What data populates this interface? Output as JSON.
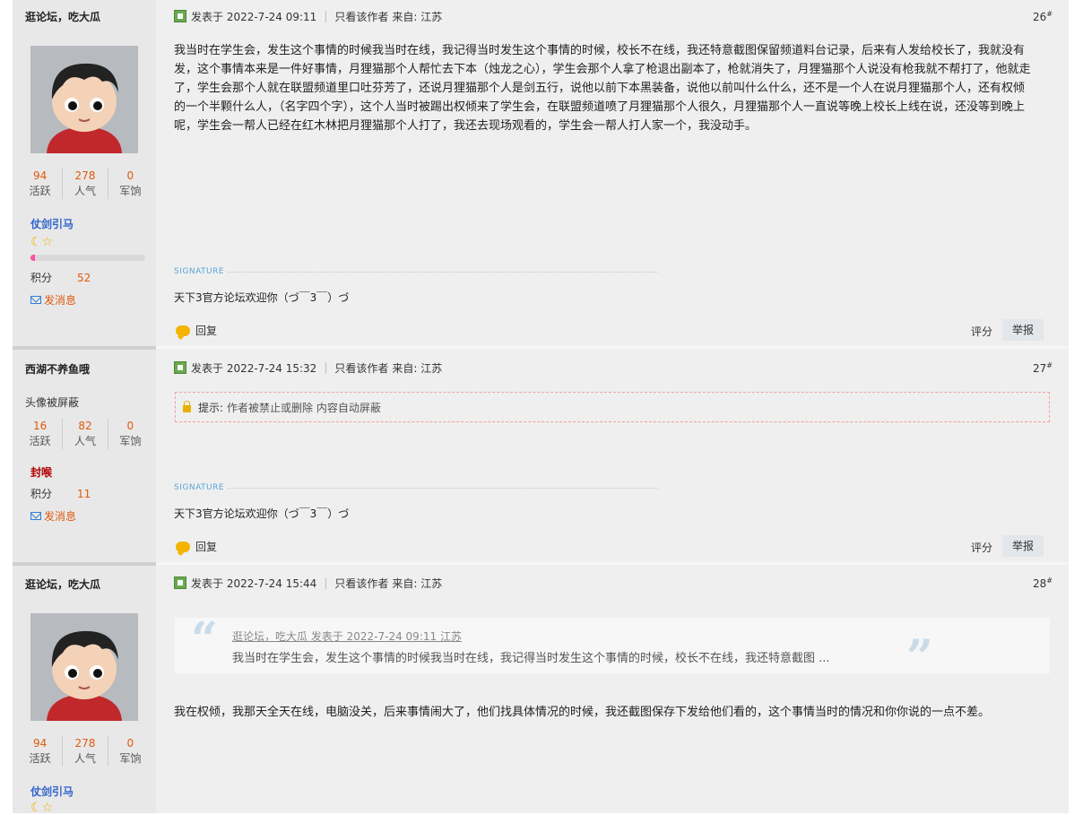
{
  "posts": [
    {
      "author": "逛论坛，吃大瓜",
      "stats": [
        {
          "n": "94",
          "l": "活跃"
        },
        {
          "n": "278",
          "l": "人气"
        },
        {
          "n": "0",
          "l": "军饷"
        }
      ],
      "group": "仗剑引马",
      "level_icons": "☾☆",
      "score_label": "积分",
      "score_value": "52",
      "score_progress": 0.04,
      "send_msg": "发消息",
      "posted": "发表于 2022-7-24 09:11",
      "only_author": "只看该作者",
      "from": "来自: 江苏",
      "floor": "26",
      "content": "我当时在学生会，发生这个事情的时候我当时在线，我记得当时发生这个事情的时候，校长不在线，我还特意截图保留频道料台记录，后来有人发给校长了，我就没有发，这个事情本来是一件好事情，月狸猫那个人帮忙去下本（烛龙之心），学生会那个人拿了枪退出副本了，枪就消失了，月狸猫那个人说没有枪我就不帮打了，他就走了，学生会那个人就在联盟频道里口吐芬芳了，还说月狸猫那个人是剑五行，说他以前下本黑装备，说他以前叫什么什么，还不是一个人在说月狸猫那个人，还有权倾的一个半颗什么人，（名字四个字），这个人当时被踢出权倾来了学生会，在联盟频道喷了月狸猫那个人很久，月狸猫那个人一直说等晚上校长上线在说，还没等到晚上呢，学生会一帮人已经在红木林把月狸猫那个人打了，我还去现场观看的，学生会一帮人打人家一个，我没动手。",
      "sig_label": "SIGNATURE",
      "signature": "天下3官方论坛欢迎你（づ￣3￣）づ",
      "reply": "回复",
      "rate": "评分",
      "report": "举报"
    },
    {
      "author": "西湖不养鱼哦",
      "avatar_blocked": "头像被屏蔽",
      "stats": [
        {
          "n": "16",
          "l": "活跃"
        },
        {
          "n": "82",
          "l": "人气"
        },
        {
          "n": "0",
          "l": "军饷"
        }
      ],
      "group": "封喉",
      "score_label": "积分",
      "score_value": "11",
      "send_msg": "发消息",
      "posted": "发表于 2022-7-24 15:32",
      "only_author": "只看该作者",
      "from": "来自: 江苏",
      "floor": "27",
      "notice_label": "提示:",
      "notice_text": "作者被禁止或删除 内容自动屏蔽",
      "sig_label": "SIGNATURE",
      "signature": "天下3官方论坛欢迎你（づ￣3￣）づ",
      "reply": "回复",
      "rate": "评分",
      "report": "举报"
    },
    {
      "author": "逛论坛，吃大瓜",
      "stats": [
        {
          "n": "94",
          "l": "活跃"
        },
        {
          "n": "278",
          "l": "人气"
        },
        {
          "n": "0",
          "l": "军饷"
        }
      ],
      "group": "仗剑引马",
      "level_icons": "☾☆",
      "posted": "发表于 2022-7-24 15:44",
      "only_author": "只看该作者",
      "from": "来自: 江苏",
      "floor": "28",
      "quote_head": "逛论坛，吃大瓜 发表于 2022-7-24 09:11 江苏",
      "quote_text": "我当时在学生会，发生这个事情的时候我当时在线，我记得当时发生这个事情的时候，校长不在线，我还特意截图 ...",
      "content": "我在权倾，我那天全天在线，电脑没关，后来事情闹大了，他们找具体情况的时候，我还截图保存下发给他们看的，这个事情当时的情况和你你说的一点不差。"
    }
  ]
}
